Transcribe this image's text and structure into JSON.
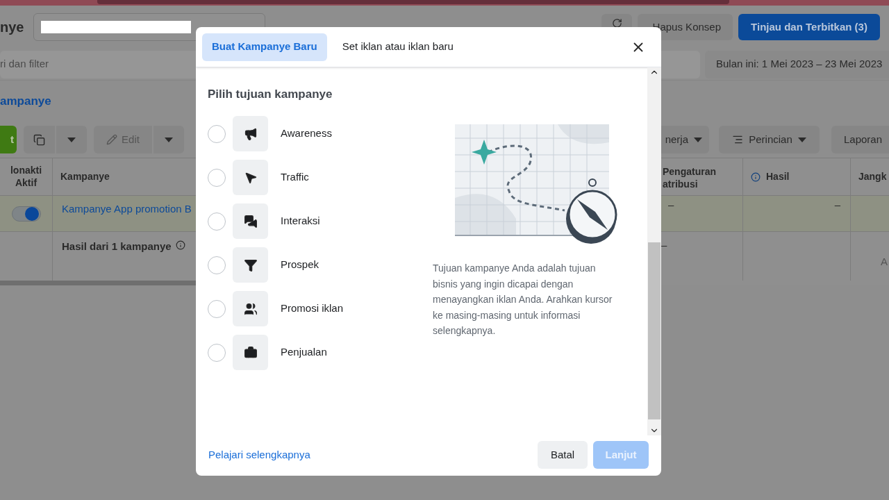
{
  "header": {
    "title": "nye",
    "review_button": "Tinjau dan Terbitkan (3)",
    "discard_button": "Hapus Konsep"
  },
  "filter": {
    "placeholder": "ri dan filter",
    "date_range": "Bulan ini: 1 Mei 2023 – 23 Mei 2023"
  },
  "section_link": "ampanye",
  "toolbar": {
    "create_button": "t",
    "edit_button": "Edit",
    "performance_button": "nerja",
    "breakdown_button": "Perincian",
    "reports_button": "Laporan"
  },
  "table": {
    "columns": [
      {
        "label": "lonakti\nAktif"
      },
      {
        "label": "Kampanye"
      },
      {
        "label": "Pengaturan\natribusi"
      },
      {
        "label": "Hasil"
      },
      {
        "label": "Jangk"
      }
    ],
    "rows": [
      {
        "on": true,
        "campaign": "Kampanye App promotion B",
        "attribution": "–",
        "results": "–"
      }
    ],
    "summary": {
      "label": "Hasil dari 1 kampanye",
      "attribution": "–",
      "column_5": "A"
    }
  },
  "modal": {
    "tabs": [
      {
        "label": "Buat Kampanye Baru",
        "selected": true
      },
      {
        "label": "Set iklan atau iklan baru",
        "selected": false
      }
    ],
    "heading": "Pilih tujuan kampanye",
    "objectives": [
      {
        "label": "Awareness",
        "selected": false
      },
      {
        "label": "Traffic",
        "selected": false
      },
      {
        "label": "Interaksi",
        "selected": false
      },
      {
        "label": "Prospek",
        "selected": false
      },
      {
        "label": "Promosi iklan",
        "selected": false
      },
      {
        "label": "Penjualan",
        "selected": false
      }
    ],
    "description": "Tujuan kampanye Anda adalah tujuan bisnis yang ingin dicapai dengan menayangkan iklan Anda. Arahkan kursor ke masing-masing untuk informasi selengkapnya.",
    "learn_more_link": "Pelajari selengkapnya",
    "cancel_button": "Batal",
    "next_button": {
      "label": "Lanjut",
      "disabled": true
    }
  }
}
